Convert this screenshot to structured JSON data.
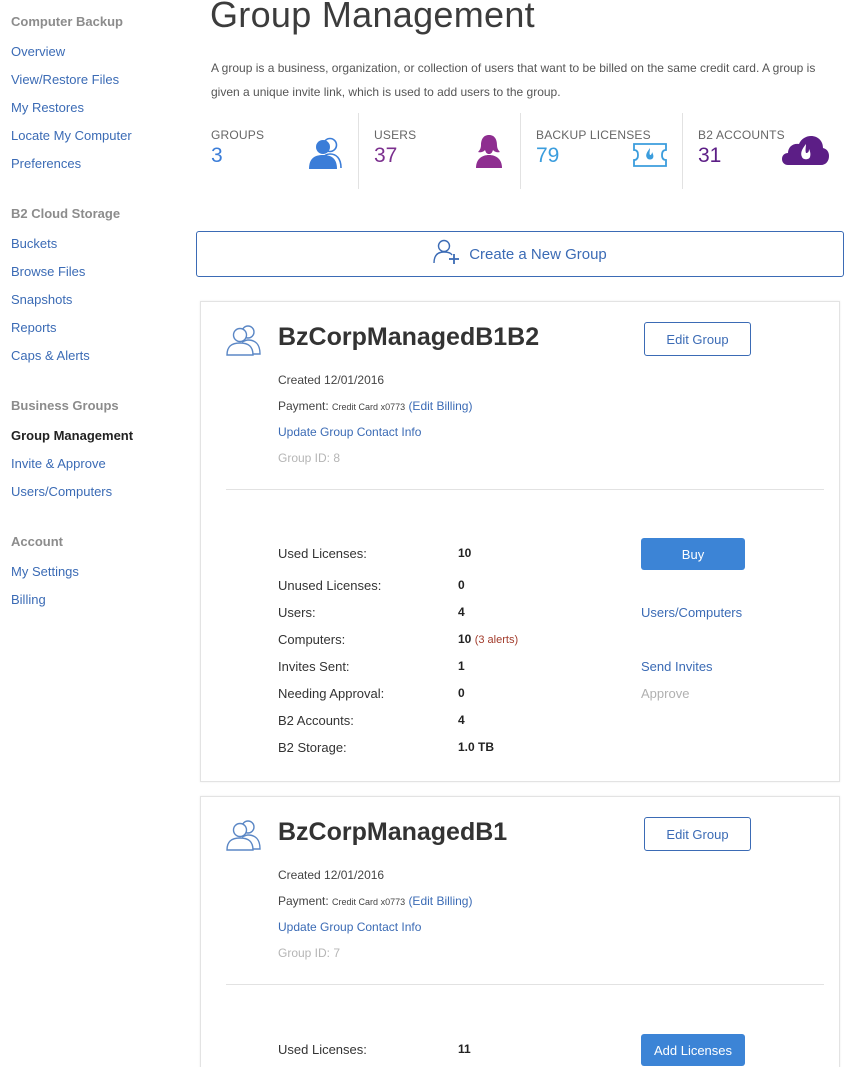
{
  "sidebar": {
    "sections": [
      {
        "title": "Computer Backup",
        "items": [
          {
            "label": "Overview"
          },
          {
            "label": "View/Restore Files"
          },
          {
            "label": "My Restores"
          },
          {
            "label": "Locate My Computer"
          },
          {
            "label": "Preferences"
          }
        ]
      },
      {
        "title": "B2 Cloud Storage",
        "items": [
          {
            "label": "Buckets"
          },
          {
            "label": "Browse Files"
          },
          {
            "label": "Snapshots"
          },
          {
            "label": "Reports"
          },
          {
            "label": "Caps & Alerts"
          }
        ]
      },
      {
        "title": "Business Groups",
        "items": [
          {
            "label": "Group Management",
            "active": true
          },
          {
            "label": "Invite & Approve"
          },
          {
            "label": "Users/Computers"
          }
        ]
      },
      {
        "title": "Account",
        "items": [
          {
            "label": "My Settings"
          },
          {
            "label": "Billing"
          }
        ]
      }
    ]
  },
  "page": {
    "title": "Group Management",
    "intro": "A group is a business, organization, or collection of users that want to be billed on the same credit card. A group is given a unique invite link, which is used to add users to the group."
  },
  "stats": [
    {
      "label": "GROUPS",
      "value": "3",
      "color": "#3b7dd8",
      "icon": "groups-icon"
    },
    {
      "label": "USERS",
      "value": "37",
      "color": "#7b2f8e",
      "icon": "user-icon"
    },
    {
      "label": "BACKUP LICENSES",
      "value": "79",
      "color": "#3b9ddd",
      "icon": "license-ticket-icon"
    },
    {
      "label": "B2 ACCOUNTS",
      "value": "31",
      "color": "#5c1e86",
      "icon": "b2-cloud-icon"
    }
  ],
  "create_button": {
    "label": "Create a New Group"
  },
  "groups": [
    {
      "name": "BzCorpManagedB1B2",
      "edit_label": "Edit Group",
      "created": "Created 12/01/2016",
      "payment_label": "Payment:",
      "payment_method": "Credit Card x0773",
      "edit_billing": "(Edit Billing)",
      "update_contact": "Update Group Contact Info",
      "group_id": "Group ID: 8",
      "rows": [
        {
          "label": "Used Licenses:",
          "value": "10"
        },
        {
          "label": "Unused Licenses:",
          "value": "0"
        },
        {
          "label": "Users:",
          "value": "4"
        },
        {
          "label": "Computers:",
          "value": "10",
          "alert": "(3 alerts)"
        },
        {
          "label": "Invites Sent:",
          "value": "1"
        },
        {
          "label": "Needing Approval:",
          "value": "0"
        },
        {
          "label": "B2 Accounts:",
          "value": "4"
        },
        {
          "label": "B2 Storage:",
          "value": "1.0 TB"
        }
      ],
      "actions": {
        "primary": "Buy",
        "users_computers": "Users/Computers",
        "send_invites": "Send Invites",
        "approve": "Approve"
      }
    },
    {
      "name": "BzCorpManagedB1",
      "edit_label": "Edit Group",
      "created": "Created 12/01/2016",
      "payment_label": "Payment:",
      "payment_method": "Credit Card x0773",
      "edit_billing": "(Edit Billing)",
      "update_contact": "Update Group Contact Info",
      "group_id": "Group ID: 7",
      "rows": [
        {
          "label": "Used Licenses:",
          "value": "11"
        }
      ],
      "actions": {
        "primary": "Add Licenses"
      }
    }
  ]
}
